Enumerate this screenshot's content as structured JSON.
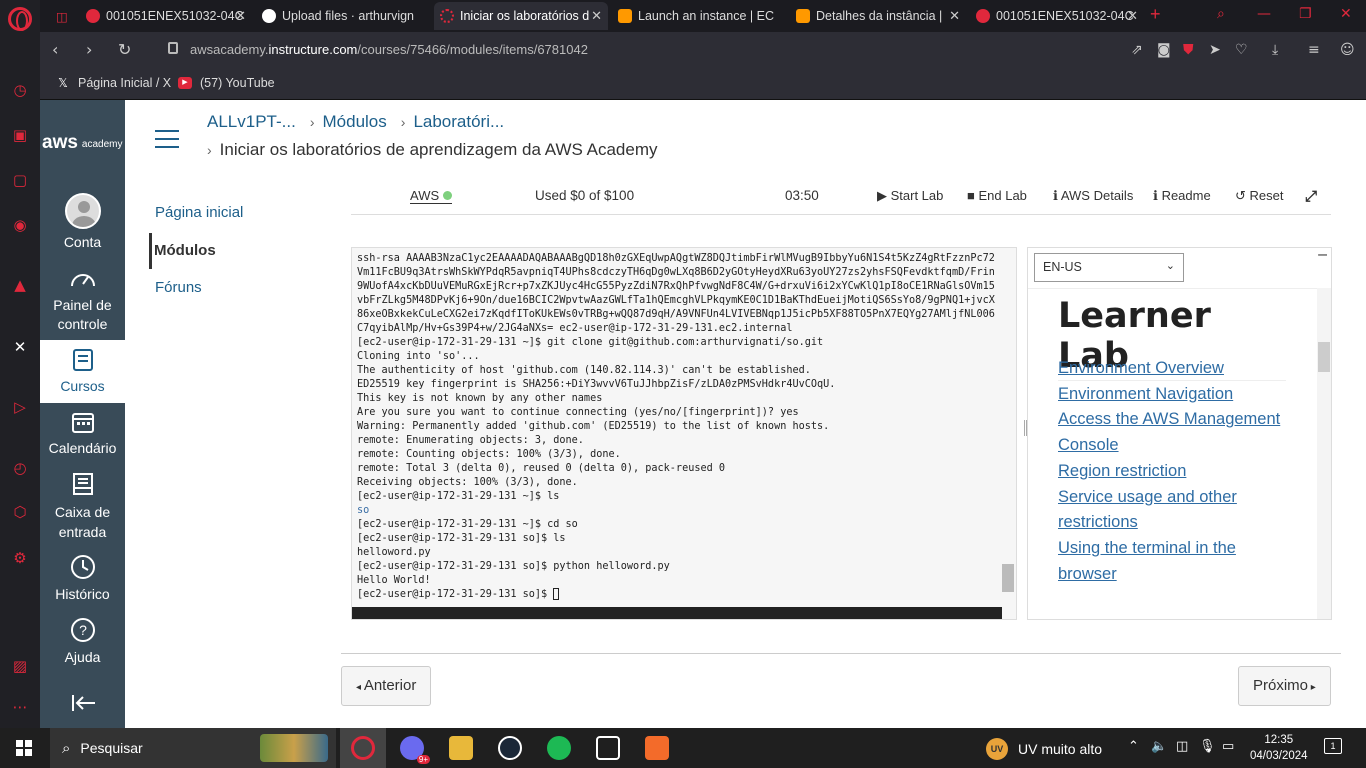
{
  "browser": {
    "tabs": [
      {
        "title": "001051ENEX51032-04C",
        "icon": "moodle-icon",
        "color": "#e0283c"
      },
      {
        "title": "Upload files · arthurvign",
        "icon": "github-icon",
        "color": "#ffffff"
      },
      {
        "title": "Iniciar os laboratórios d",
        "icon": "loading-icon",
        "color": "#e0283c"
      },
      {
        "title": "Launch an instance | EC",
        "icon": "aws-ec2-icon",
        "color": "#ff9900"
      },
      {
        "title": "Detalhes da instância |",
        "icon": "aws-ec2-icon",
        "color": "#ff9900"
      },
      {
        "title": "001051ENEX51032-04C",
        "icon": "moodle-icon",
        "color": "#e0283c"
      }
    ],
    "url_prefix": "awsacademy.",
    "url_host": "instructure.com",
    "url_path": "/courses/75466/modules/items/6781042",
    "bookmarks": [
      {
        "label": "Página Inicial / X",
        "icon": "x-icon"
      },
      {
        "label": "(57) YouTube",
        "icon": "youtube-icon"
      }
    ]
  },
  "global_nav": {
    "brand": "aws",
    "brand_sub": "academy",
    "items": [
      {
        "label": "Conta",
        "icon": "account-icon"
      },
      {
        "label": "Painel de controle",
        "icon": "dashboard-icon"
      },
      {
        "label": "Cursos",
        "icon": "courses-icon",
        "active": true
      },
      {
        "label": "Calendário",
        "icon": "calendar-icon"
      },
      {
        "label": "Caixa de entrada",
        "icon": "inbox-icon"
      },
      {
        "label": "Histórico",
        "icon": "history-icon"
      },
      {
        "label": "Ajuda",
        "icon": "help-icon"
      }
    ]
  },
  "breadcrumbs": {
    "course": "ALLv1PT-...",
    "modules": "Módulos",
    "labs": "Laboratóri...",
    "current": "Iniciar os laboratórios de aprendizagem da AWS Academy"
  },
  "course_nav": {
    "home": "Página inicial",
    "modules": "Módulos",
    "forums": "Fóruns"
  },
  "lab_toolbar": {
    "aws": "AWS",
    "status_color": "#7ed07e",
    "budget": "Used $0 of $100",
    "timer": "03:50",
    "start": "Start Lab",
    "end": "End Lab",
    "details": "AWS Details",
    "readme": "Readme",
    "reset": "Reset"
  },
  "terminal": {
    "lines": [
      "ssh-rsa AAAAB3NzaC1yc2EAAAADAQABAAABgQD18h0zGXEqUwpAQgtWZ8DQJtimbFirWlMVugB9IbbyYu6N1S4t5KzZ4gRtFzznPc72",
      "Vm11FcBU9q3AtrsWhSkWYPdqR5avpniqT4UPhs8cdczyTH6qDg0wLXq8B6D2yGOtyHeydXRu63yoUY27zs2yhsFSQFevdktfqmD/Frin",
      "9WUofA4xcKbDUuVEMuRGxEjRcr+p7xZKJUyc4HcG55PyzZdiN7RxQhPfvwgNdF8C4W/G+drxuVi6i2xYCwKlQ1pI8oCE1RNaGlsOVm15",
      "vbFrZLkg5M48DPvKj6+9On/due16BCIC2WpvtwAazGWLfTa1hQEmcghVLPkqymKE0C1D1BaKThdEueijMotiQS6SsYo8/9gPNQ1+jvcX",
      "86xeOBxkekCuLeCXG2ei7zKqdfIToKUkEWs0vTRBg+wQQ87d9qH/A9VNFUn4LVIVEBNqp1J5icPb5XF88TO5PnX7EQYg27AMljfNL006",
      "C7qyibAlMp/Hv+Gs39P4+w/2JG4aNXs= ec2-user@ip-172-31-29-131.ec2.internal",
      "[ec2-user@ip-172-31-29-131 ~]$ git clone git@github.com:arthurvignati/so.git",
      "Cloning into 'so'...",
      "The authenticity of host 'github.com (140.82.114.3)' can't be established.",
      "ED25519 key fingerprint is SHA256:+DiY3wvvV6TuJJhbpZisF/zLDA0zPMSvHdkr4UvCOqU.",
      "This key is not known by any other names",
      "Are you sure you want to continue connecting (yes/no/[fingerprint])? yes",
      "Warning: Permanently added 'github.com' (ED25519) to the list of known hosts.",
      "remote: Enumerating objects: 3, done.",
      "remote: Counting objects: 100% (3/3), done.",
      "remote: Total 3 (delta 0), reused 0 (delta 0), pack-reused 0",
      "Receiving objects: 100% (3/3), done.",
      "[ec2-user@ip-172-31-29-131 ~]$ ls",
      "so",
      "[ec2-user@ip-172-31-29-131 ~]$ cd so",
      "[ec2-user@ip-172-31-29-131 so]$ ls",
      "helloword.py",
      "[ec2-user@ip-172-31-29-131 so]$ python helloword.py",
      "Hello World!",
      "[ec2-user@ip-172-31-29-131 so]$ "
    ]
  },
  "readme_panel": {
    "language": "EN-US",
    "title": "Learner Lab",
    "links": [
      "Environment Overview",
      "Environment Navigation",
      "Access the AWS Management Console",
      "Region restriction",
      "Service usage and other restrictions",
      "Using the terminal in the browser"
    ]
  },
  "pager": {
    "prev": "Anterior",
    "next": "Próximo"
  },
  "taskbar": {
    "search_placeholder": "Pesquisar",
    "weather": "UV muito alto",
    "weather_badge": "UV",
    "time": "12:35",
    "date": "04/03/2024",
    "notifications": "1",
    "app_badge": "9+"
  }
}
